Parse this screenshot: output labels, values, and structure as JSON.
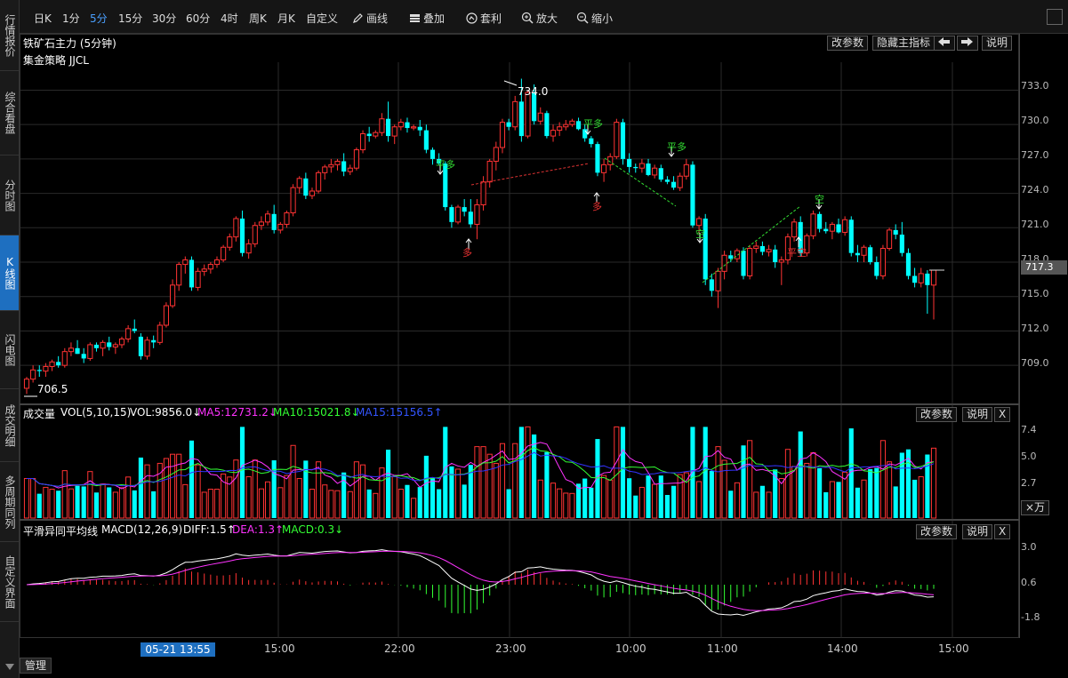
{
  "sidebar": {
    "items": [
      {
        "label": "行情报价",
        "active": false
      },
      {
        "label": "综合看盘",
        "active": false
      },
      {
        "label": "分时图",
        "active": false
      },
      {
        "label": "K线图",
        "active": true
      },
      {
        "label": "闪电图",
        "active": false
      },
      {
        "label": "成交明细",
        "active": false
      },
      {
        "label": "多周期同列",
        "active": false
      },
      {
        "label": "自定义界面",
        "active": false
      }
    ]
  },
  "toolbar": {
    "periods": [
      "日K",
      "1分",
      "5分",
      "15分",
      "30分",
      "60分",
      "4时",
      "周K",
      "月K",
      "自定义"
    ],
    "active_period": "5分",
    "draw": "画线",
    "overlay": "叠加",
    "arbitrage": "套利",
    "zoom_in": "放大",
    "zoom_out": "缩小"
  },
  "main_chart": {
    "title": "铁矿石主力 (5分钟)",
    "strategy": "集金策略 JJCL",
    "buttons": {
      "edit_params": "改参数",
      "hide_indicator": "隐藏主指标",
      "explain": "说明"
    },
    "high_label": "734.0",
    "low_label": "706.5",
    "current_price": "717.3",
    "price_ticks": [
      "733.0",
      "730.0",
      "727.0",
      "724.0",
      "721.0",
      "718.0",
      "715.0",
      "712.0",
      "709.0"
    ],
    "signals": [
      {
        "text": "平多",
        "color": "#33dd33"
      },
      {
        "text": "多",
        "color": "#ee3333"
      },
      {
        "text": "平多",
        "color": "#33dd33"
      },
      {
        "text": "多",
        "color": "#ee3333"
      },
      {
        "text": "平多",
        "color": "#33dd33"
      },
      {
        "text": "空",
        "color": "#33dd33"
      },
      {
        "text": "平空",
        "color": "#ee3333"
      },
      {
        "text": "空",
        "color": "#33dd33"
      }
    ]
  },
  "volume_panel": {
    "label": "成交量",
    "indicator": "VOL(5,10,15)",
    "vol": "VOL:9856.0↓",
    "ma5": "MA5:12731.2↓",
    "ma10": "MA10:15021.8↓",
    "ma15": "MA15:15156.5↑",
    "edit_params": "改参数",
    "explain": "说明",
    "close": "X",
    "ticks": [
      "7.4",
      "5.0",
      "2.7"
    ],
    "unit": "×万"
  },
  "macd_panel": {
    "label": "平滑异同平均线",
    "indicator": "MACD(12,26,9)",
    "diff": "DIFF:1.5↑",
    "dea": "DEA:1.3↑",
    "macd": "MACD:0.3↓",
    "edit_params": "改参数",
    "explain": "说明",
    "close": "X",
    "ticks": [
      "3.0",
      "0.6",
      "-1.8"
    ]
  },
  "time_axis": {
    "highlight": "05-21 13:55",
    "labels": [
      "15:00",
      "22:00",
      "23:00",
      "10:00",
      "11:00",
      "14:00",
      "15:00"
    ]
  },
  "bottom_tab": "管理",
  "colors": {
    "up": "#ff3333",
    "down": "#00ffff",
    "ma5": "#ff33ff",
    "ma10": "#33ff33",
    "ma15": "#3333ff"
  },
  "chart_data": {
    "type": "candlestick",
    "title": "铁矿石主力 (5分钟)",
    "ylim": [
      706.0,
      735.5
    ],
    "candles": [
      [
        707.0,
        708.0,
        706.5,
        707.8
      ],
      [
        707.8,
        709.0,
        707.5,
        708.6
      ],
      [
        708.6,
        709.0,
        708.0,
        708.5
      ],
      [
        708.5,
        709.2,
        708.0,
        708.9
      ],
      [
        708.9,
        709.5,
        708.5,
        709.3
      ],
      [
        709.3,
        709.8,
        708.8,
        709.0
      ],
      [
        709.0,
        710.5,
        708.8,
        710.2
      ],
      [
        710.2,
        711.0,
        709.8,
        710.5
      ],
      [
        710.5,
        711.2,
        710.0,
        710.0
      ],
      [
        710.0,
        710.5,
        709.2,
        709.6
      ],
      [
        709.6,
        711.0,
        709.4,
        710.8
      ],
      [
        710.8,
        711.0,
        710.2,
        710.5
      ],
      [
        710.5,
        711.2,
        709.8,
        711.0
      ],
      [
        711.0,
        711.5,
        710.3,
        710.6
      ],
      [
        710.6,
        711.0,
        710.0,
        710.8
      ],
      [
        710.8,
        711.5,
        710.5,
        711.3
      ],
      [
        711.3,
        712.5,
        711.0,
        712.2
      ],
      [
        712.2,
        713.0,
        711.8,
        712.0
      ],
      [
        711.5,
        711.8,
        709.5,
        709.8
      ],
      [
        709.8,
        711.5,
        709.5,
        711.2
      ],
      [
        711.2,
        711.6,
        710.5,
        711.0
      ],
      [
        711.0,
        712.8,
        710.8,
        712.5
      ],
      [
        712.5,
        714.5,
        712.3,
        714.2
      ],
      [
        714.2,
        716.5,
        714.0,
        716.0
      ],
      [
        716.0,
        718.0,
        715.5,
        717.8
      ],
      [
        717.8,
        718.5,
        717.0,
        718.2
      ],
      [
        718.2,
        718.5,
        715.5,
        715.8
      ],
      [
        715.8,
        717.5,
        715.5,
        717.2
      ],
      [
        717.2,
        717.8,
        716.8,
        717.4
      ],
      [
        717.4,
        718.0,
        717.0,
        717.8
      ],
      [
        717.8,
        718.5,
        717.5,
        718.2
      ],
      [
        718.2,
        719.5,
        718.0,
        719.3
      ],
      [
        719.3,
        720.5,
        719.0,
        720.2
      ],
      [
        720.2,
        722.0,
        719.8,
        721.8
      ],
      [
        721.8,
        722.5,
        718.5,
        718.8
      ],
      [
        718.8,
        720.0,
        718.3,
        719.6
      ],
      [
        719.6,
        721.5,
        719.3,
        721.2
      ],
      [
        721.2,
        722.0,
        720.8,
        721.5
      ],
      [
        721.5,
        722.5,
        721.2,
        722.2
      ],
      [
        722.2,
        723.0,
        720.5,
        720.8
      ],
      [
        720.8,
        721.5,
        720.5,
        721.3
      ],
      [
        721.3,
        722.5,
        721.0,
        722.3
      ],
      [
        722.3,
        724.8,
        722.0,
        724.5
      ],
      [
        724.5,
        725.5,
        724.0,
        725.3
      ],
      [
        725.3,
        725.8,
        723.5,
        723.8
      ],
      [
        723.8,
        724.5,
        723.5,
        724.2
      ],
      [
        724.2,
        726.0,
        724.0,
        725.8
      ],
      [
        725.8,
        726.5,
        725.2,
        726.3
      ],
      [
        726.3,
        727.0,
        725.8,
        726.5
      ],
      [
        726.5,
        727.0,
        726.0,
        726.8
      ],
      [
        726.8,
        727.5,
        725.5,
        725.9
      ],
      [
        725.9,
        726.5,
        725.6,
        726.2
      ],
      [
        726.2,
        728.0,
        726.0,
        727.8
      ],
      [
        727.8,
        729.5,
        727.5,
        729.2
      ],
      [
        729.2,
        729.8,
        728.5,
        729.0
      ],
      [
        729.0,
        729.5,
        728.8,
        729.3
      ],
      [
        729.3,
        731.0,
        729.0,
        730.5
      ],
      [
        730.5,
        732.0,
        728.5,
        729.0
      ],
      [
        729.0,
        730.0,
        728.3,
        729.8
      ],
      [
        729.8,
        730.5,
        729.5,
        730.2
      ],
      [
        730.2,
        730.6,
        729.3,
        729.7
      ],
      [
        729.7,
        730.0,
        729.5,
        729.8
      ],
      [
        729.8,
        730.4,
        729.0,
        729.5
      ],
      [
        729.5,
        730.0,
        727.5,
        727.8
      ],
      [
        727.8,
        728.0,
        726.5,
        727.0
      ],
      [
        727.0,
        727.5,
        726.5,
        726.6
      ],
      [
        726.6,
        726.8,
        722.5,
        722.8
      ],
      [
        722.8,
        723.0,
        721.0,
        721.5
      ],
      [
        721.5,
        723.0,
        721.3,
        722.8
      ],
      [
        722.8,
        723.5,
        722.0,
        722.4
      ],
      [
        722.4,
        723.5,
        721.0,
        721.3
      ],
      [
        721.3,
        723.5,
        720.0,
        723.0
      ],
      [
        723.0,
        725.5,
        722.5,
        725.0
      ],
      [
        725.0,
        727.0,
        724.5,
        726.8
      ],
      [
        726.8,
        728.5,
        726.0,
        728.0
      ],
      [
        728.0,
        730.5,
        727.5,
        730.2
      ],
      [
        730.2,
        730.5,
        729.5,
        729.8
      ],
      [
        729.8,
        732.5,
        729.5,
        732.0
      ],
      [
        732.0,
        734.0,
        728.5,
        729.0
      ],
      [
        729.0,
        733.0,
        728.8,
        732.8
      ],
      [
        732.8,
        733.5,
        730.0,
        730.3
      ],
      [
        730.3,
        731.5,
        730.0,
        731.0
      ],
      [
        731.0,
        731.2,
        728.8,
        729.0
      ],
      [
        729.0,
        730.0,
        728.5,
        729.5
      ],
      [
        729.5,
        730.2,
        729.0,
        729.8
      ],
      [
        729.8,
        730.4,
        729.5,
        730.0
      ],
      [
        730.0,
        730.5,
        729.8,
        730.3
      ],
      [
        730.3,
        730.6,
        729.5,
        729.6
      ],
      [
        729.6,
        730.0,
        728.5,
        728.8
      ],
      [
        728.8,
        729.0,
        728.0,
        728.3
      ],
      [
        728.3,
        728.5,
        725.5,
        725.8
      ],
      [
        725.8,
        727.0,
        725.0,
        726.5
      ],
      [
        726.5,
        727.5,
        726.0,
        727.2
      ],
      [
        727.2,
        730.5,
        727.0,
        730.2
      ],
      [
        730.2,
        730.5,
        726.5,
        727.0
      ],
      [
        727.0,
        727.5,
        725.8,
        726.3
      ],
      [
        726.3,
        726.6,
        725.8,
        726.2
      ],
      [
        726.2,
        727.0,
        725.8,
        726.6
      ],
      [
        726.6,
        727.0,
        725.5,
        725.6
      ],
      [
        725.6,
        726.5,
        725.3,
        726.2
      ],
      [
        726.2,
        726.5,
        725.0,
        725.2
      ],
      [
        725.2,
        725.5,
        724.8,
        725.0
      ],
      [
        725.0,
        725.5,
        724.3,
        724.5
      ],
      [
        724.5,
        725.8,
        724.2,
        725.5
      ],
      [
        725.5,
        727.0,
        725.2,
        726.5
      ],
      [
        726.5,
        726.8,
        721.0,
        721.2
      ],
      [
        721.2,
        722.0,
        720.5,
        721.8
      ],
      [
        721.8,
        722.2,
        716.0,
        716.5
      ],
      [
        716.5,
        717.0,
        715.0,
        715.5
      ],
      [
        715.5,
        717.5,
        714.0,
        717.2
      ],
      [
        717.2,
        719.0,
        716.5,
        718.6
      ],
      [
        718.6,
        719.0,
        718.0,
        718.3
      ],
      [
        718.3,
        719.2,
        718.0,
        719.0
      ],
      [
        719.0,
        719.3,
        716.5,
        716.8
      ],
      [
        716.8,
        719.5,
        716.5,
        719.2
      ],
      [
        719.2,
        719.8,
        718.8,
        719.4
      ],
      [
        719.4,
        719.8,
        718.6,
        718.9
      ],
      [
        718.9,
        719.5,
        718.5,
        719.1
      ],
      [
        719.1,
        719.5,
        717.5,
        718.0
      ],
      [
        718.0,
        718.5,
        716.0,
        718.2
      ],
      [
        718.2,
        720.5,
        717.8,
        720.2
      ],
      [
        720.2,
        721.8,
        719.8,
        721.5
      ],
      [
        721.5,
        722.0,
        718.5,
        718.8
      ],
      [
        718.8,
        720.5,
        718.5,
        720.3
      ],
      [
        720.3,
        722.5,
        720.0,
        722.2
      ],
      [
        722.2,
        722.4,
        720.6,
        720.9
      ],
      [
        720.9,
        721.5,
        720.5,
        720.7
      ],
      [
        720.7,
        721.5,
        720.0,
        721.3
      ],
      [
        721.3,
        721.8,
        720.5,
        720.6
      ],
      [
        720.6,
        722.0,
        720.3,
        721.7
      ],
      [
        721.7,
        722.0,
        718.5,
        718.8
      ],
      [
        718.8,
        719.5,
        718.0,
        718.6
      ],
      [
        718.6,
        719.5,
        718.0,
        719.3
      ],
      [
        719.3,
        719.5,
        717.8,
        718.0
      ],
      [
        718.0,
        718.5,
        716.5,
        716.8
      ],
      [
        716.8,
        719.5,
        716.5,
        719.2
      ],
      [
        719.2,
        721.0,
        719.0,
        720.8
      ],
      [
        720.8,
        721.3,
        720.0,
        720.4
      ],
      [
        720.4,
        721.5,
        718.5,
        718.8
      ],
      [
        718.8,
        719.2,
        716.5,
        716.8
      ],
      [
        716.8,
        717.5,
        715.8,
        716.2
      ],
      [
        716.2,
        717.5,
        715.8,
        717.0
      ],
      [
        717.0,
        717.3,
        713.5,
        716.0
      ],
      [
        716.0,
        717.0,
        713.0,
        717.3
      ]
    ],
    "volumes": [],
    "macd_hist": [],
    "diff": [],
    "dea": []
  }
}
